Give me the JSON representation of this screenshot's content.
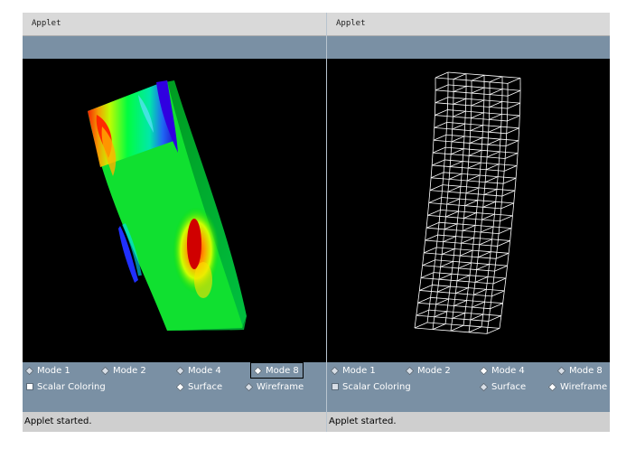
{
  "left_applet": {
    "title": "Applet",
    "modes": [
      {
        "label": "Mode 1",
        "selected": false,
        "focused": false
      },
      {
        "label": "Mode 2",
        "selected": false,
        "focused": false
      },
      {
        "label": "Mode 4",
        "selected": false,
        "focused": false
      },
      {
        "label": "Mode 8",
        "selected": true,
        "focused": true
      }
    ],
    "scalar_coloring_label": "Scalar Coloring",
    "scalar_coloring_checked": true,
    "render_options": [
      {
        "label": "Surface",
        "selected": true
      },
      {
        "label": "Wireframe",
        "selected": false
      }
    ],
    "status": "Applet started."
  },
  "right_applet": {
    "title": "Applet",
    "modes": [
      {
        "label": "Mode 1",
        "selected": false
      },
      {
        "label": "Mode 2",
        "selected": false
      },
      {
        "label": "Mode 4",
        "selected": true
      },
      {
        "label": "Mode 8",
        "selected": false
      }
    ],
    "scalar_coloring_label": "Scalar Coloring",
    "scalar_coloring_checked": false,
    "render_options": [
      {
        "label": "Surface",
        "selected": false
      },
      {
        "label": "Wireframe",
        "selected": true
      }
    ],
    "status": "Applet started."
  },
  "colors": {
    "panel": "#7a90a4",
    "canvas": "#000000",
    "titlebar": "#d9d9d9",
    "status": "#cfcfcf",
    "wireframe": "#ffffff"
  }
}
